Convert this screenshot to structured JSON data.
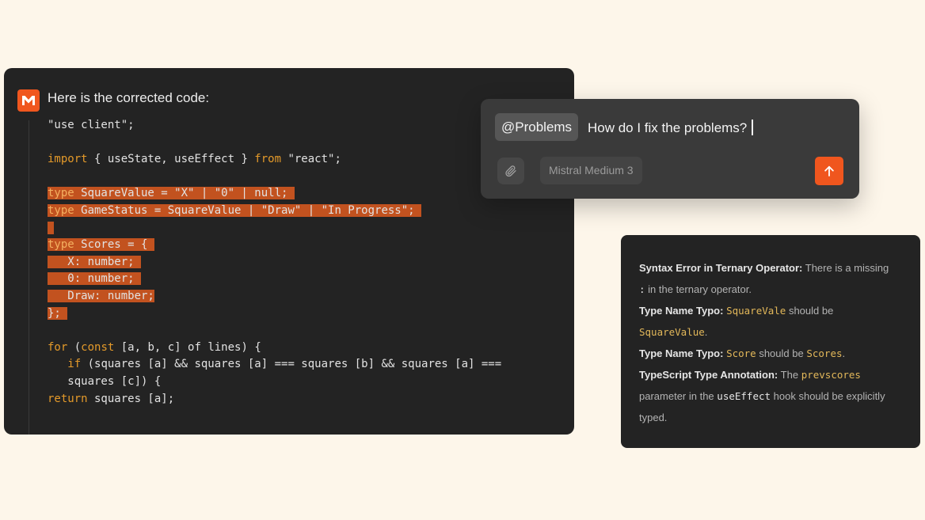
{
  "code_panel": {
    "logo_letter": "M",
    "intro": "Here is the corrected code:",
    "lines": [
      "\"use client\";",
      "",
      "import { useState, useEffect } from \"react\";",
      "",
      "type SquareValue = \"X\" | \"0\" | null;",
      "type GameStatus = SquareValue | \"Draw\" | \"In Progress\";",
      "",
      "type Scores = {",
      "   X: number;",
      "   0: number;",
      "   Draw: number;",
      "};",
      "",
      "for (const [a, b, c] of lines) {",
      "   if (squares [a] && squares [a] === squares [b] && squares [a] ===",
      "   squares [c]) {",
      "return squares [a];"
    ]
  },
  "chat": {
    "mention": "@Problems",
    "query": "How do I fix the problems?",
    "model": "Mistral Medium 3",
    "attach_icon": "paperclip-icon",
    "send_icon": "arrow-up-icon"
  },
  "problems": {
    "p1": {
      "title": "Syntax Error in Ternary Operator:",
      "text_a": "There is a missing",
      "code": ":",
      "text_b": "in the ternary operator."
    },
    "p2": {
      "title": "Type Name Typo:",
      "code_a": "SquareVale",
      "text_a": "should be",
      "code_b": "SquareValue",
      "text_b": "."
    },
    "p3": {
      "title": "Type Name Typo:",
      "code_a": "Score",
      "text_a": "should be",
      "code_b": "Scores",
      "text_b": "."
    },
    "p4": {
      "title": "TypeScript Type Annotation:",
      "text_a": "The",
      "code_a": "prevscores",
      "text_b": "parameter in the",
      "code_b": "useEffect",
      "text_c": "hook should be explicitly typed."
    }
  },
  "colors": {
    "page_bg": "#fdf6ea",
    "panel_bg": "#232323",
    "accent": "#f0561e",
    "highlight": "#c2521f",
    "keyword": "#e49a2a"
  }
}
